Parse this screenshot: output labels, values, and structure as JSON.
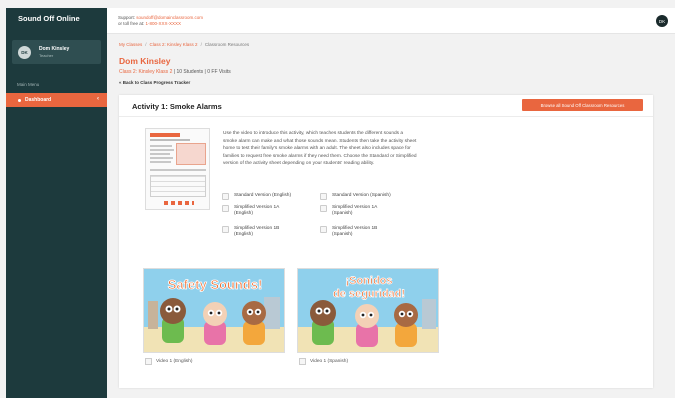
{
  "app": {
    "title": "Sound Off Online"
  },
  "user": {
    "initials": "DK",
    "name": "Dom Kinsley",
    "role": "Teacher"
  },
  "sidebar": {
    "menu_heading": "Main Menu",
    "items": [
      {
        "label": "Dashboard",
        "icon": "dot-icon"
      }
    ]
  },
  "topbar": {
    "support_label": "Support:",
    "support_email": "soundoff@domainclassroom.com",
    "toll_free_label": "or toll free at:",
    "toll_free_number": "1-800-XXX-XXXX",
    "avatar_initials": "DK"
  },
  "breadcrumb": [
    "My Classes",
    "Class 2: Kinsley Klass 2",
    "Classroom Resources"
  ],
  "header": {
    "student_name": "Dom Kinsley",
    "class_name": "Class 2: Kinsley Klass 2",
    "separator": "|",
    "students": "10 Students",
    "ff_visits": "0 FF Visits",
    "back_link": "« Back to Class Progress Tracker"
  },
  "activity": {
    "title": "Activity 1: Smoke Alarms",
    "browse_button": "Browse all Sound Off Classroom Resources",
    "description": "Use the video to introduce this activity, which teaches students the different sounds a smoke alarm can make and what those sounds mean. Students then take the activity sheet home to test their family's smoke alarms with an adult. The sheet also includes space for families to request free smoke alarms if they need them. Choose the Standard or Simplified version of the activity sheet depending on your students' reading ability.",
    "versions": [
      {
        "line1": "Standard Version (English)",
        "line2": ""
      },
      {
        "line1": "Standard Version (Spanish)",
        "line2": ""
      },
      {
        "line1": "Simplified Version 1A",
        "line2": "(English)"
      },
      {
        "line1": "Simplified Version 1A",
        "line2": "(Spanish)"
      },
      {
        "line1": "Simplified Version 1B",
        "line2": "(English)"
      },
      {
        "line1": "Simplified Version 1B",
        "line2": "(Spanish)"
      }
    ],
    "videos": [
      {
        "label": "Video 1 (English)",
        "thumb_title_1": "Safety Sounds!",
        "thumb_title_2": ""
      },
      {
        "label": "Video 1 (Spanish)",
        "thumb_title_1": "¡Sonidos",
        "thumb_title_2": "de seguridad!"
      }
    ]
  },
  "colors": {
    "accent": "#e9663f",
    "sidebar_bg": "#1d3a3d",
    "sky": "#8fd0ec",
    "ground": "#f1e3b5"
  }
}
